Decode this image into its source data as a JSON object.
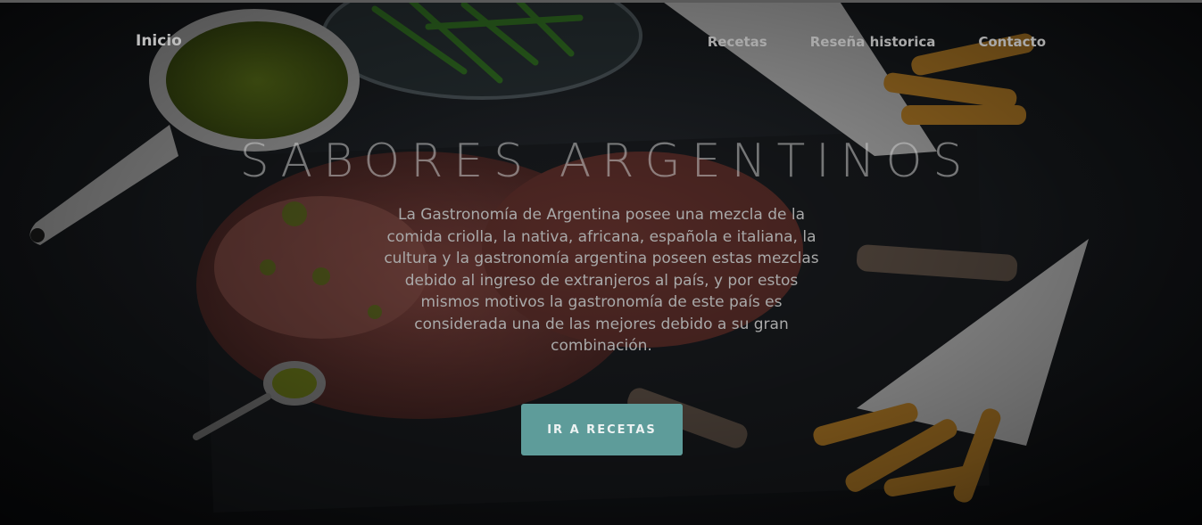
{
  "nav": {
    "brand": "Inicio",
    "links": [
      "Recetas",
      "Reseña historica",
      "Contacto"
    ]
  },
  "hero": {
    "title": "SABORES ARGENTINOS",
    "description": "La Gastronomía de Argentina posee una mezcla de la comida criolla, la nativa, africana, española e italiana, la cultura y la gastronomía argentina poseen estas mezclas debido al ingreso de extranjeros al país, y por estos mismos motivos la gastronomía de este país es considerada una de las mejores debido a su gran combinación.",
    "button": "IR A RECETAS"
  },
  "colors": {
    "button_bg": "#5e9c9a",
    "overlay": "#000000"
  }
}
